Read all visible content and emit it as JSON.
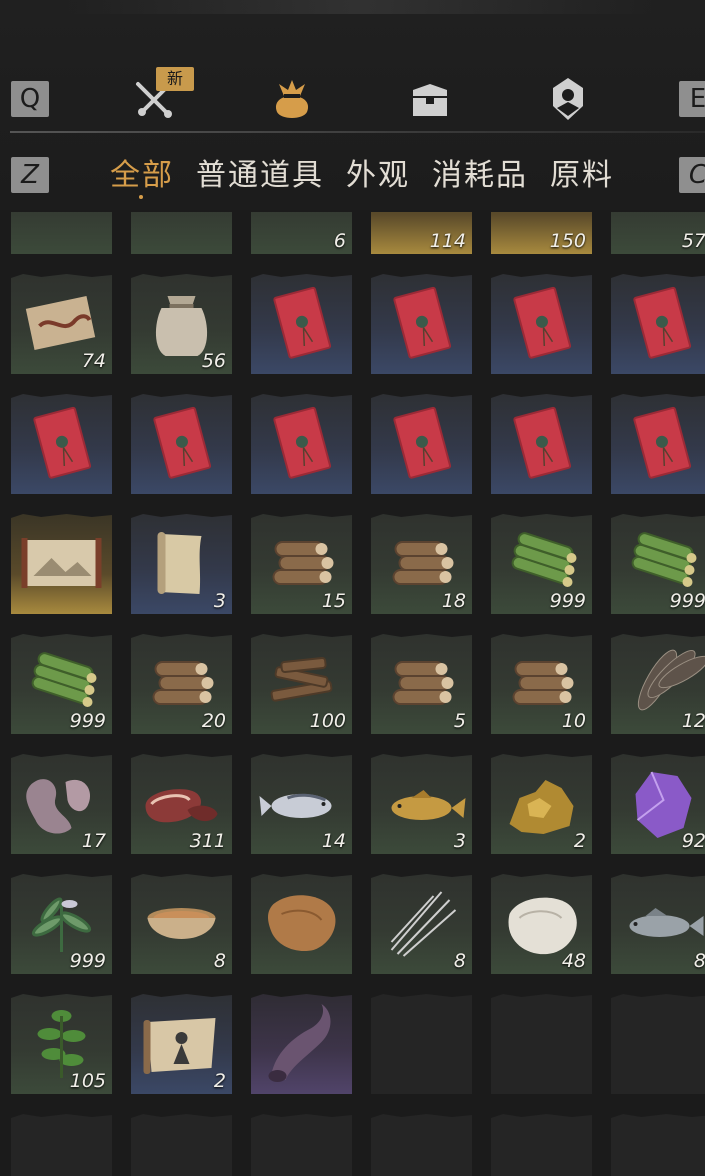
{
  "header": {
    "key_prev_category": "Q",
    "key_next_category": "E",
    "key_prev_subtab": "Z",
    "key_next_subtab": "C",
    "new_badge": "新",
    "category_tabs": [
      {
        "icon": "crossed-swords-icon",
        "active": false
      },
      {
        "icon": "pouch-icon",
        "active": true
      },
      {
        "icon": "chest-icon",
        "active": false
      },
      {
        "icon": "location-badge-icon",
        "active": false
      }
    ],
    "accent_color": "#d69d4a"
  },
  "subtabs": [
    {
      "label": "全部",
      "active": true
    },
    {
      "label": "普通道具",
      "active": false
    },
    {
      "label": "外观",
      "active": false
    },
    {
      "label": "消耗品",
      "active": false
    },
    {
      "label": "原料",
      "active": false
    }
  ],
  "inventory": {
    "rows": [
      [
        {
          "icon": "rolled-scroll-icon",
          "count": "",
          "tone": "green"
        },
        {
          "icon": "green-gourd-icon",
          "count": "",
          "tone": "green"
        },
        {
          "icon": "sweet-potato-icon",
          "count": "6",
          "tone": "green"
        },
        {
          "icon": "cauldron-icon",
          "count": "114",
          "tone": "gold"
        },
        {
          "icon": "coin-icon",
          "count": "150",
          "tone": "gold"
        },
        {
          "icon": "scroll-icon",
          "count": "57",
          "tone": "green"
        }
      ],
      [
        {
          "icon": "worm-bait-icon",
          "count": "74",
          "tone": "green"
        },
        {
          "icon": "cloth-sack-icon",
          "count": "56",
          "tone": "green"
        },
        {
          "icon": "red-envelope-icon",
          "count": "",
          "tone": "blue"
        },
        {
          "icon": "red-envelope-icon",
          "count": "",
          "tone": "blue"
        },
        {
          "icon": "red-envelope-icon",
          "count": "",
          "tone": "blue"
        },
        {
          "icon": "red-envelope-icon",
          "count": "",
          "tone": "blue"
        }
      ],
      [
        {
          "icon": "red-envelope-icon",
          "count": "",
          "tone": "blue"
        },
        {
          "icon": "red-envelope-icon",
          "count": "",
          "tone": "blue"
        },
        {
          "icon": "red-envelope-icon",
          "count": "",
          "tone": "blue"
        },
        {
          "icon": "red-envelope-icon",
          "count": "",
          "tone": "blue"
        },
        {
          "icon": "red-envelope-icon",
          "count": "",
          "tone": "blue"
        },
        {
          "icon": "red-envelope-icon",
          "count": "",
          "tone": "blue"
        }
      ],
      [
        {
          "icon": "painting-scroll-icon",
          "count": "",
          "tone": "gold"
        },
        {
          "icon": "blank-scroll-icon",
          "count": "3",
          "tone": "blue"
        },
        {
          "icon": "log-pile-icon",
          "count": "15",
          "tone": "green"
        },
        {
          "icon": "log-pile-icon",
          "count": "18",
          "tone": "green"
        },
        {
          "icon": "bamboo-bundle-icon",
          "count": "999",
          "tone": "green"
        },
        {
          "icon": "bamboo-bundle-icon",
          "count": "999",
          "tone": "green"
        }
      ],
      [
        {
          "icon": "bamboo-bundle-icon",
          "count": "999",
          "tone": "green"
        },
        {
          "icon": "log-pile-icon",
          "count": "20",
          "tone": "green"
        },
        {
          "icon": "firewood-icon",
          "count": "100",
          "tone": "green"
        },
        {
          "icon": "log-pile-icon",
          "count": "5",
          "tone": "green"
        },
        {
          "icon": "log-pile-icon",
          "count": "10",
          "tone": "green"
        },
        {
          "icon": "feathers-icon",
          "count": "12",
          "tone": "green"
        }
      ],
      [
        {
          "icon": "animal-hide-icon",
          "count": "17",
          "tone": "green"
        },
        {
          "icon": "raw-meat-icon",
          "count": "311",
          "tone": "green"
        },
        {
          "icon": "fish-icon",
          "count": "14",
          "tone": "green"
        },
        {
          "icon": "carp-icon",
          "count": "3",
          "tone": "green"
        },
        {
          "icon": "gold-ore-icon",
          "count": "2",
          "tone": "green"
        },
        {
          "icon": "amethyst-icon",
          "count": "92",
          "tone": "green"
        }
      ],
      [
        {
          "icon": "herb-plant-icon",
          "count": "999",
          "tone": "green"
        },
        {
          "icon": "soup-bowl-icon",
          "count": "8",
          "tone": "green"
        },
        {
          "icon": "fur-pelt-icon",
          "count": "",
          "tone": "green"
        },
        {
          "icon": "quills-icon",
          "count": "8",
          "tone": "green"
        },
        {
          "icon": "white-fleece-icon",
          "count": "48",
          "tone": "green"
        },
        {
          "icon": "perch-fish-icon",
          "count": "8",
          "tone": "green"
        }
      ],
      [
        {
          "icon": "green-herb-icon",
          "count": "105",
          "tone": "green"
        },
        {
          "icon": "portrait-scroll-icon",
          "count": "2",
          "tone": "blue"
        },
        {
          "icon": "horn-icon",
          "count": "",
          "tone": "purple"
        },
        {
          "icon": "",
          "count": "",
          "tone": "empty"
        },
        {
          "icon": "",
          "count": "",
          "tone": "empty"
        },
        {
          "icon": "",
          "count": "",
          "tone": "empty"
        }
      ],
      [
        {
          "icon": "",
          "count": "",
          "tone": "empty"
        },
        {
          "icon": "",
          "count": "",
          "tone": "empty"
        },
        {
          "icon": "",
          "count": "",
          "tone": "empty"
        },
        {
          "icon": "",
          "count": "",
          "tone": "empty"
        },
        {
          "icon": "",
          "count": "",
          "tone": "empty"
        },
        {
          "icon": "",
          "count": "",
          "tone": "empty"
        }
      ]
    ]
  }
}
